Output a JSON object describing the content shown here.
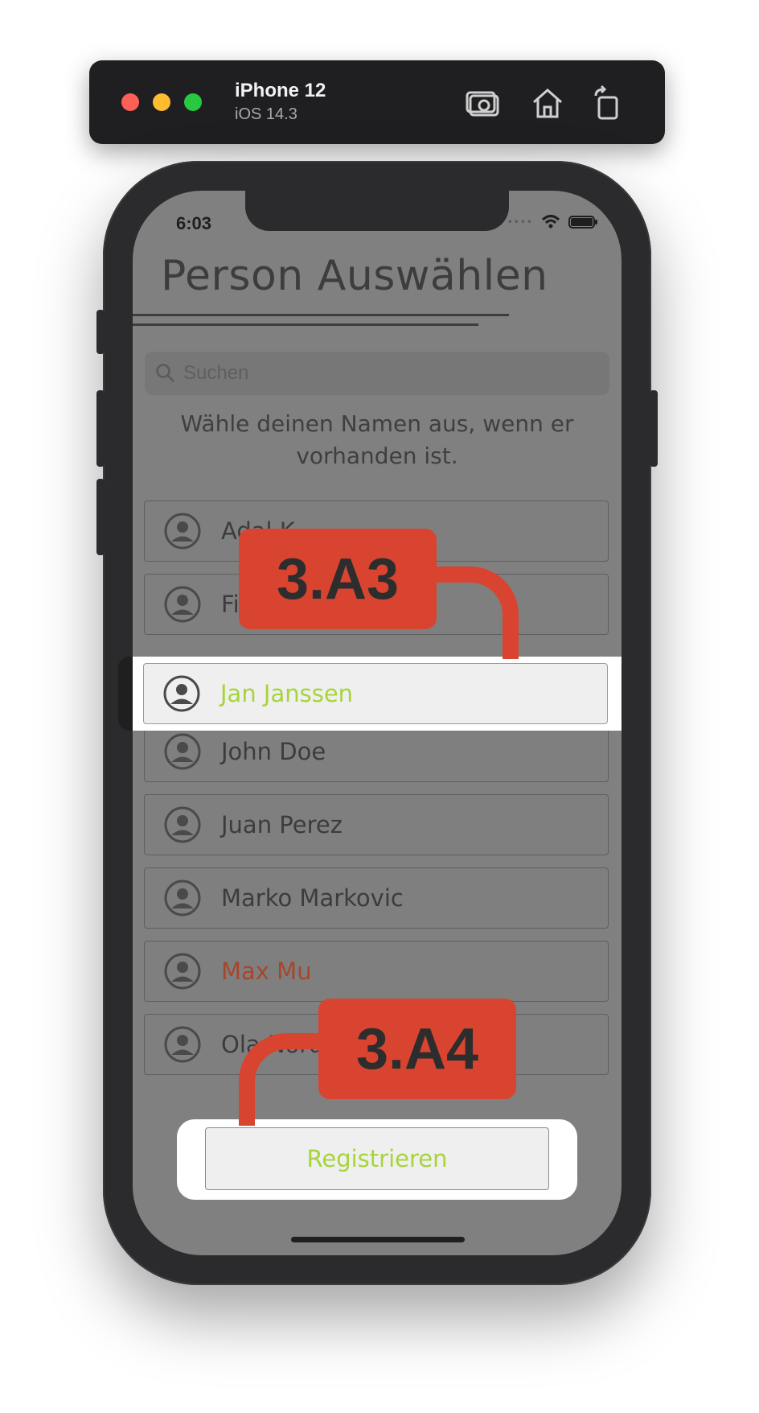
{
  "simulator": {
    "device_name": "iPhone 12",
    "os_version": "iOS 14.3",
    "toolbar_icons": [
      "screenshot-icon",
      "home-icon",
      "rotate-icon"
    ]
  },
  "status_bar": {
    "time": "6:03",
    "icons": [
      "wifi-icon",
      "battery-icon"
    ]
  },
  "page": {
    "title": "Person Auswählen",
    "search_placeholder": "Suchen",
    "instruction": "Wähle deinen Namen aus, wenn er vorhanden ist."
  },
  "persons": [
    {
      "name": "Adal K"
    },
    {
      "name": "Fi"
    },
    {
      "name": "Jan Janssen",
      "selected": true
    },
    {
      "name": "John Doe"
    },
    {
      "name": "Juan Perez"
    },
    {
      "name": "Marko Markovic"
    },
    {
      "name": "Max Mu"
    },
    {
      "name": "Ola Nordmann"
    }
  ],
  "register_button": "Registrieren",
  "callouts": {
    "a3": "3.A3",
    "a4": "3.A4"
  },
  "colors": {
    "accent_green": "#a7d43a",
    "callout_red": "#d94430",
    "overlay_gray": "#808080",
    "warning_name": "#a8462a"
  }
}
